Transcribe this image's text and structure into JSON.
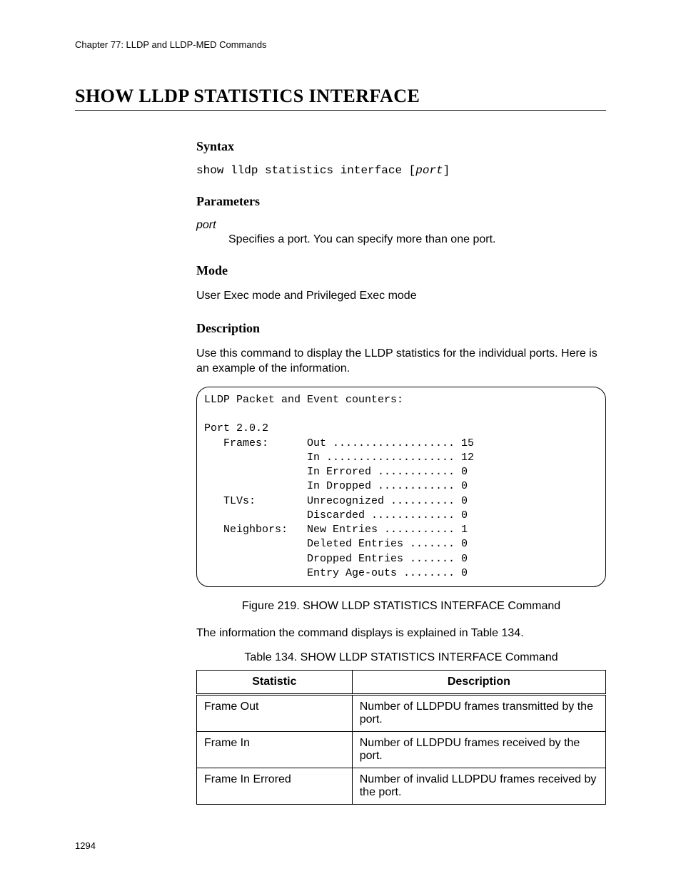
{
  "chapter_header": "Chapter 77: LLDP and LLDP-MED Commands",
  "page_title": "SHOW LLDP STATISTICS INTERFACE",
  "sections": {
    "syntax": {
      "heading": "Syntax",
      "cmd_prefix": "show lldp statistics interface [",
      "cmd_param": "port",
      "cmd_suffix": "]"
    },
    "parameters": {
      "heading": "Parameters",
      "name": "port",
      "desc": "Specifies a port. You can specify more than one port."
    },
    "mode": {
      "heading": "Mode",
      "text": "User Exec mode and Privileged Exec mode"
    },
    "description": {
      "heading": "Description",
      "intro": "Use this command to display the LLDP statistics for the individual ports. Here is an example of the information.",
      "code": "LLDP Packet and Event counters:\n\nPort 2.0.2\n   Frames:      Out ................... 15\n                In .................... 12\n                In Errored ............ 0\n                In Dropped ............ 0\n   TLVs:        Unrecognized .......... 0\n                Discarded ............. 0\n   Neighbors:   New Entries ........... 1\n                Deleted Entries ....... 0\n                Dropped Entries ....... 0\n                Entry Age-outs ........ 0",
      "figure_caption": "Figure 219. SHOW LLDP STATISTICS INTERFACE Command",
      "after_figure": "The information the command displays is explained in Table 134.",
      "table_caption": "Table 134. SHOW LLDP STATISTICS INTERFACE Command",
      "table": {
        "headers": {
          "stat": "Statistic",
          "desc": "Description"
        },
        "rows": [
          {
            "stat": "Frame Out",
            "desc": "Number of LLDPDU frames transmitted by the port."
          },
          {
            "stat": "Frame In",
            "desc": "Number of LLDPDU frames received by the port."
          },
          {
            "stat": "Frame In Errored",
            "desc": "Number of invalid LLDPDU frames received by the port."
          }
        ]
      }
    }
  },
  "page_number": "1294"
}
